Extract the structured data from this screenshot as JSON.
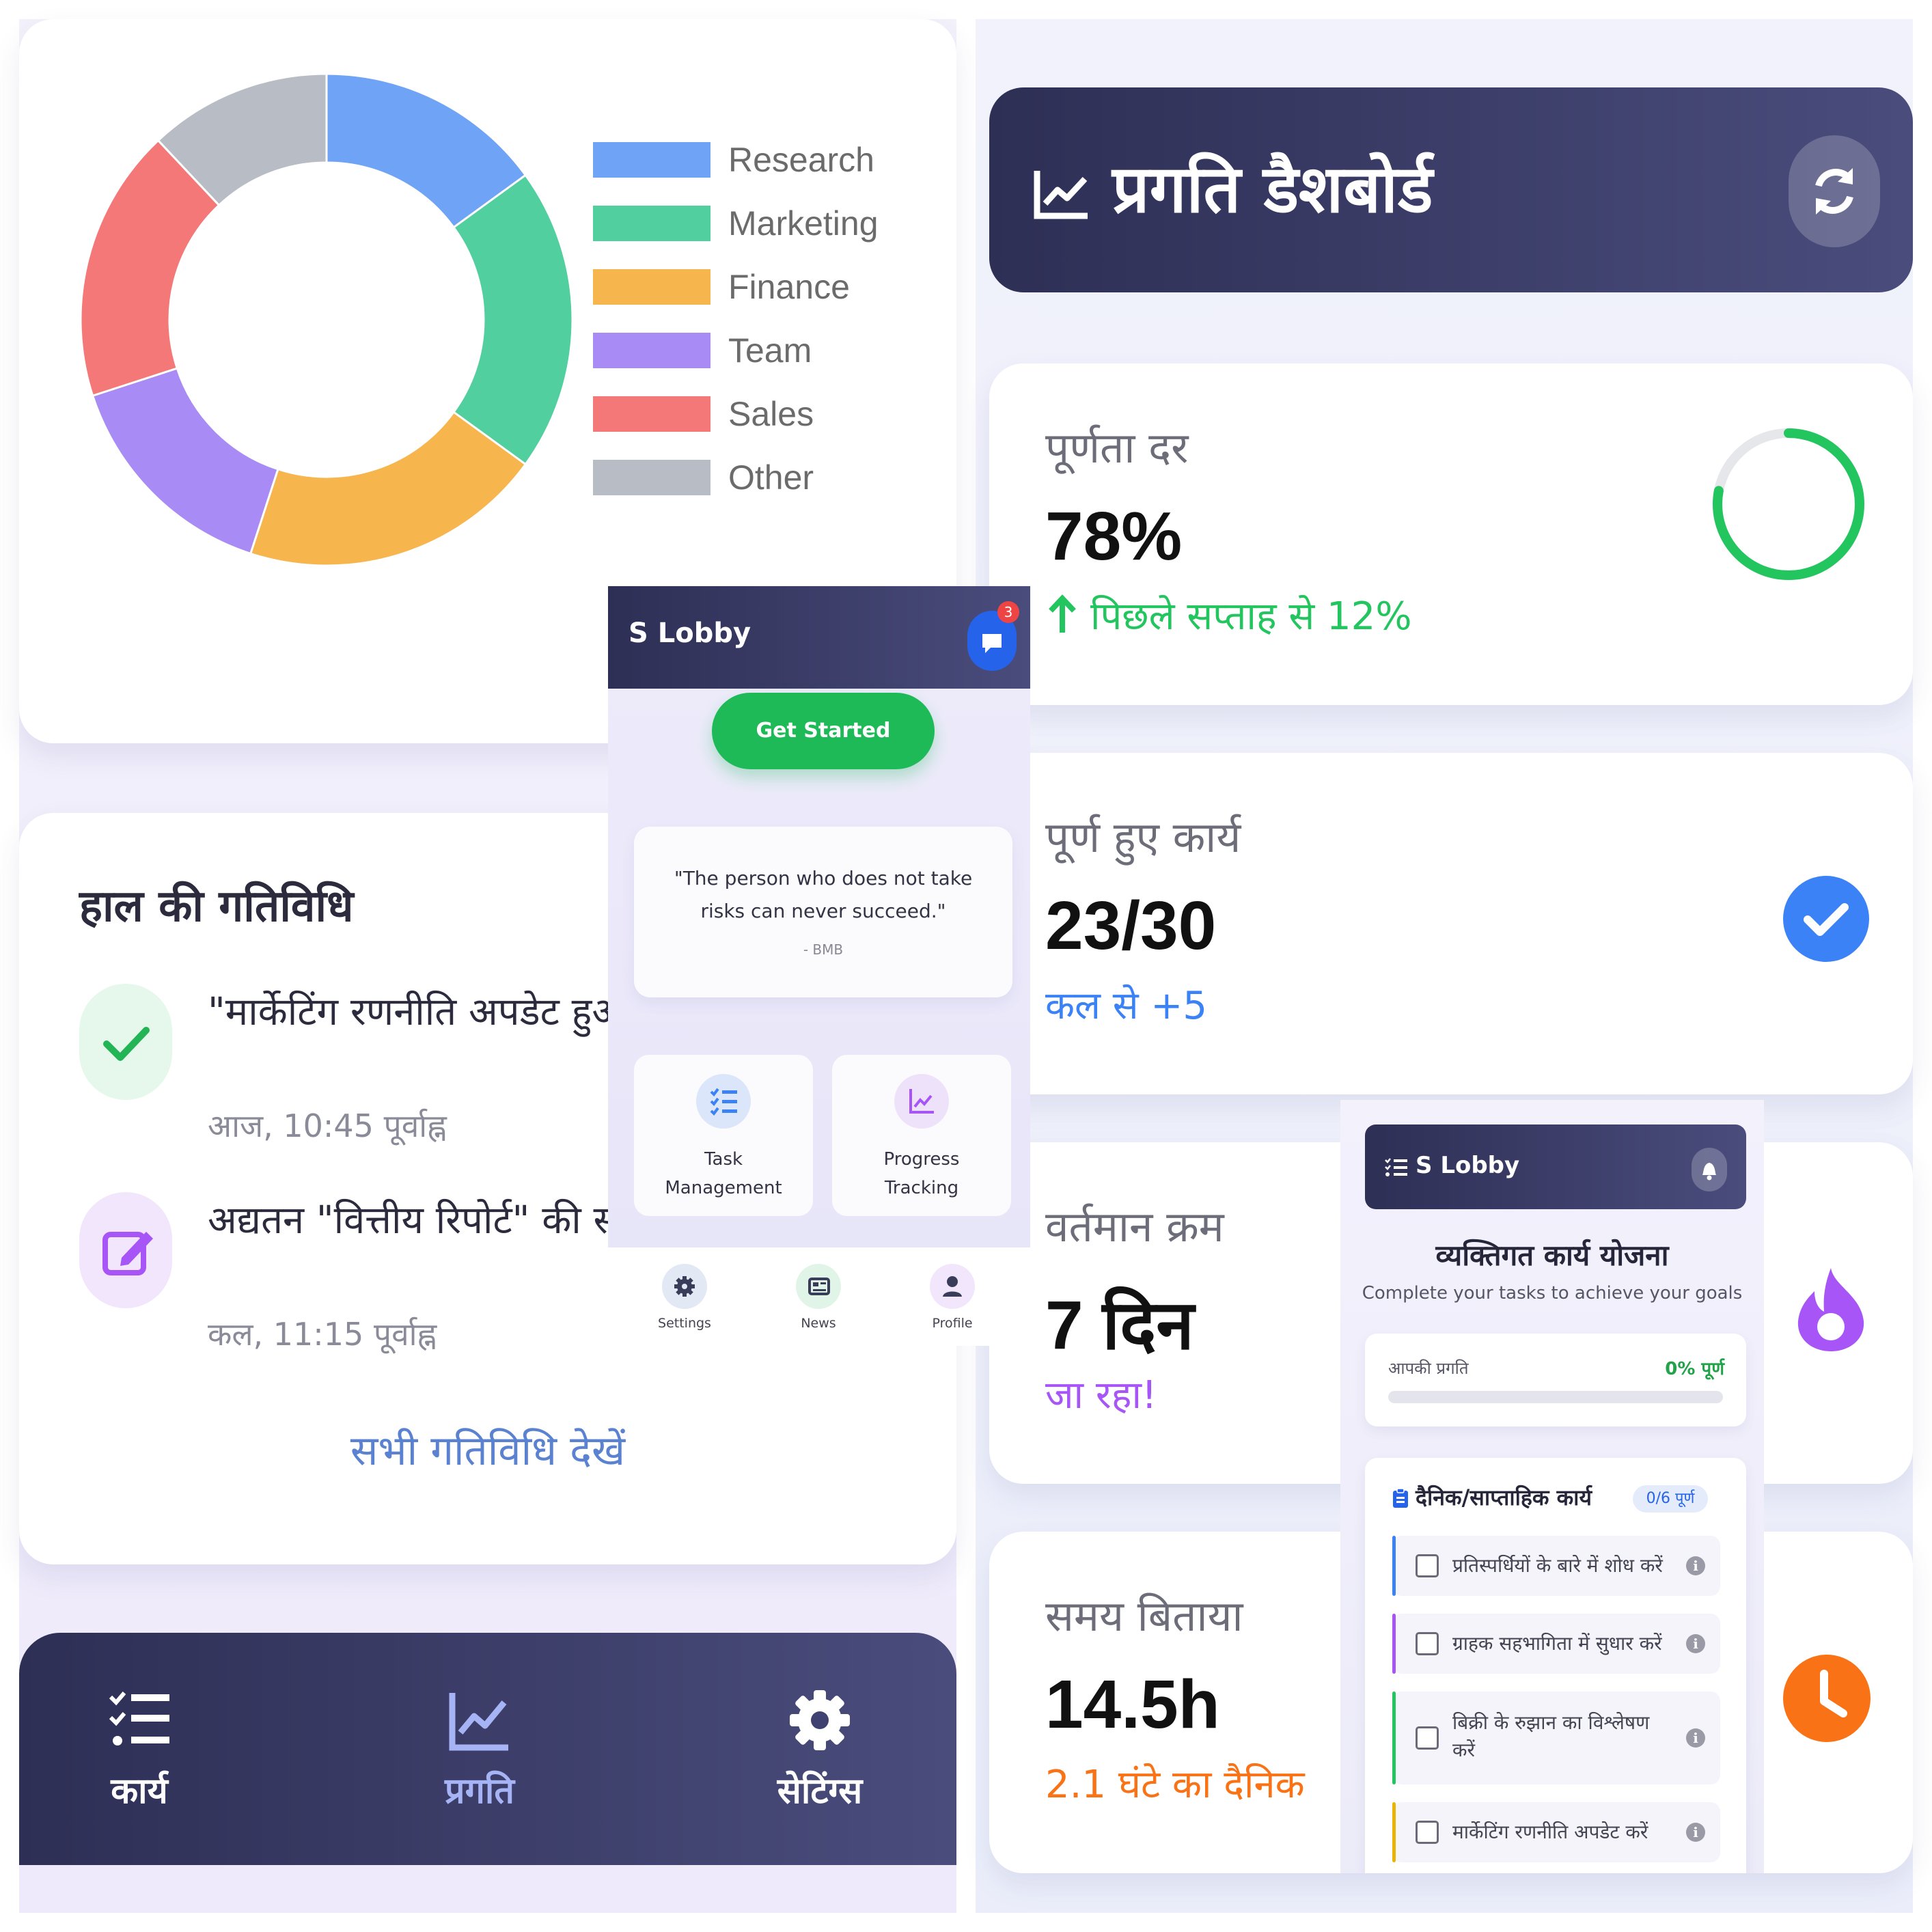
{
  "left": {
    "chart_data": {
      "type": "pie",
      "categories": [
        "Research",
        "Marketing",
        "Finance",
        "Team",
        "Sales",
        "Other"
      ],
      "values": [
        15,
        20,
        20,
        15,
        18,
        12
      ],
      "colors": [
        "#6fa3f5",
        "#52cf9e",
        "#f7b54d",
        "#a98bf5",
        "#f57878",
        "#b8bcc4"
      ],
      "title": "",
      "legend_position": "right"
    },
    "activity": {
      "title": "हाल की गतिविधि",
      "items": [
        {
          "text": "\"मार्केटिंग रणनीति अपडेट हुआ\"",
          "time": "आज, 10:45 पूर्वाह्न",
          "icon": "check-icon"
        },
        {
          "text": "अद्यतन \"वित्तीय रिपोर्ट\" की सीमा",
          "time": "कल, 11:15 पूर्वाह्न",
          "icon": "edit-icon"
        }
      ],
      "view_all": "सभी गतिविधि देखें"
    },
    "bottom_nav": [
      {
        "label": "कार्य",
        "icon": "tasks-icon",
        "color": "#ffffff"
      },
      {
        "label": "प्रगति",
        "icon": "chart-icon",
        "color": "#a6b4f5"
      },
      {
        "label": "सेटिंग्स",
        "icon": "gear-icon",
        "color": "#ffffff"
      }
    ]
  },
  "dashboard": {
    "title": "प्रगति डैशबोर्ड",
    "refresh_icon": "refresh-icon",
    "stats": [
      {
        "label": "पूर्णता दर",
        "value": "78%",
        "sub": "पिछले सप्ताह से 12%",
        "sub_color": "#22c55e",
        "progress": 0.78
      },
      {
        "label": "पूर्ण हुए कार्य",
        "value": "23/30",
        "sub": "कल से +5",
        "sub_color": "#3b82f6"
      },
      {
        "label": "वर्तमान क्रम",
        "value": "7 दिन",
        "sub": "जा रहा!",
        "sub_color": "#a855f7"
      },
      {
        "label": "समय बिताया",
        "value": "14.5h",
        "sub": "2.1 घंटे का दैनिक",
        "sub_color": "#f97316"
      }
    ]
  },
  "phone1": {
    "app_title": "S Lobby",
    "badge_count": "3",
    "cta": "Get Started",
    "quote": "\"The person who does not take risks can never succeed.\"",
    "quote_author": "- BMB",
    "features": [
      {
        "label": "Task Management",
        "icon": "list-icon"
      },
      {
        "label": "Progress Tracking",
        "icon": "chart-icon"
      }
    ],
    "nav": [
      {
        "label": "Settings",
        "icon": "gear-icon"
      },
      {
        "label": "News",
        "icon": "news-icon"
      },
      {
        "label": "Profile",
        "icon": "user-icon"
      }
    ]
  },
  "phone2": {
    "app_title": "S Lobby",
    "plan_title": "व्यक्तिगत कार्य योजना",
    "plan_subtitle": "Complete your tasks to achieve your goals",
    "progress_label": "आपकी प्रगति",
    "progress_value": "0% पूर्ण",
    "progress": 0,
    "tasks_title": "दैनिक/साप्ताहिक कार्य",
    "tasks_badge": "0/6 पूर्ण",
    "tasks": [
      {
        "label": "प्रतिस्पर्धियों के बारे में शोध करें",
        "color": "#3b82f6"
      },
      {
        "label": "ग्राहक सहभागिता में सुधार करें",
        "color": "#a855f7"
      },
      {
        "label": "बिक्री के रुझान का विश्लेषण करें",
        "color": "#22c55e"
      },
      {
        "label": "मार्केटिंग रणनीति अपडेट करें",
        "color": "#eab308"
      }
    ]
  }
}
